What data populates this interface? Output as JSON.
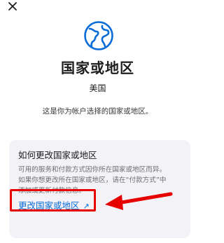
{
  "header": {
    "close_icon": "close-icon"
  },
  "hero": {
    "icon": "globe-icon",
    "icon_color": "#0a6cd6",
    "title": "国家或地区",
    "country": "美国",
    "description": "这是你为帐户选择的国家或地区。"
  },
  "card": {
    "title": "如何更改国家或地区",
    "body_lines": [
      "可用的服务和付款方式因你所在国家或地区而异。",
      "如果你想更改所在国家或地区，请在“付款方式”中",
      "添加或更新付款信息。"
    ],
    "link_label": "更改国家或地区",
    "link_icon": "external-arrow-icon",
    "link_color": "#0a6cd6"
  },
  "annotation": {
    "color": "#e60000",
    "arrow_icon": "red-arrow-icon"
  }
}
